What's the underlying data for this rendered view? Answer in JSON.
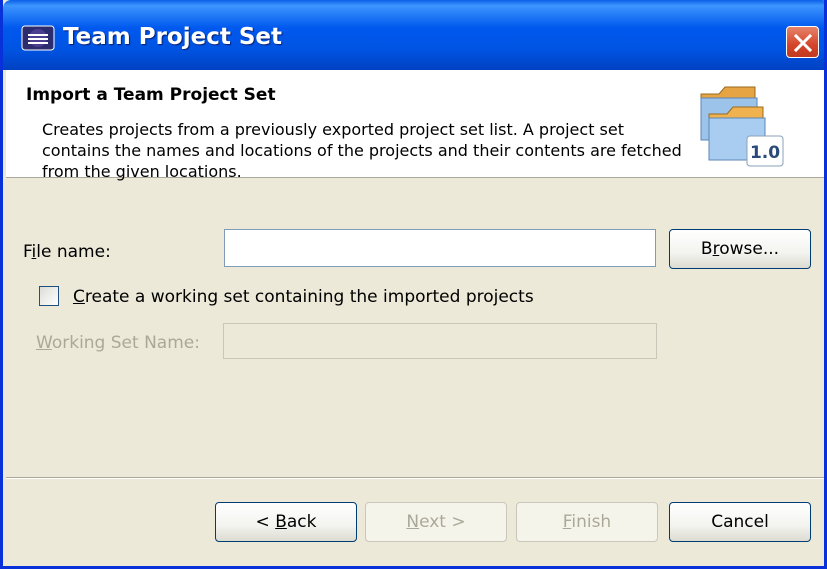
{
  "window": {
    "title": "Team Project Set"
  },
  "header": {
    "title": "Import a Team Project Set",
    "description": "Creates projects from a previously exported project set list. A project set contains the names and locations of the projects and their contents are fetched from the given locations.",
    "badge": "1.0"
  },
  "form": {
    "file_name_label": {
      "pre": "F",
      "key": "i",
      "post": "le name:"
    },
    "file_name_value": "",
    "browse": {
      "pre": "B",
      "key": "r",
      "post": "owse..."
    },
    "create_working_set": {
      "pre": "",
      "key": "C",
      "post": "reate a working set containing the imported projects",
      "checked": false
    },
    "working_set_name_label": {
      "pre": "",
      "key": "W",
      "post": "orking Set Name:"
    },
    "working_set_name_value": ""
  },
  "footer": {
    "back": {
      "pre": "< ",
      "key": "B",
      "post": "ack"
    },
    "next": {
      "pre": "",
      "key": "N",
      "post": "ext >"
    },
    "finish": {
      "pre": "",
      "key": "F",
      "post": "inish"
    },
    "cancel": "Cancel"
  },
  "colors": {
    "title_bar": "#0054e3",
    "dialog_bg": "#ece9d8",
    "close_button": "#d4452b"
  },
  "icons": {
    "title": "eclipse-app-icon",
    "header": "project-set-folders-icon",
    "close": "close-icon"
  }
}
